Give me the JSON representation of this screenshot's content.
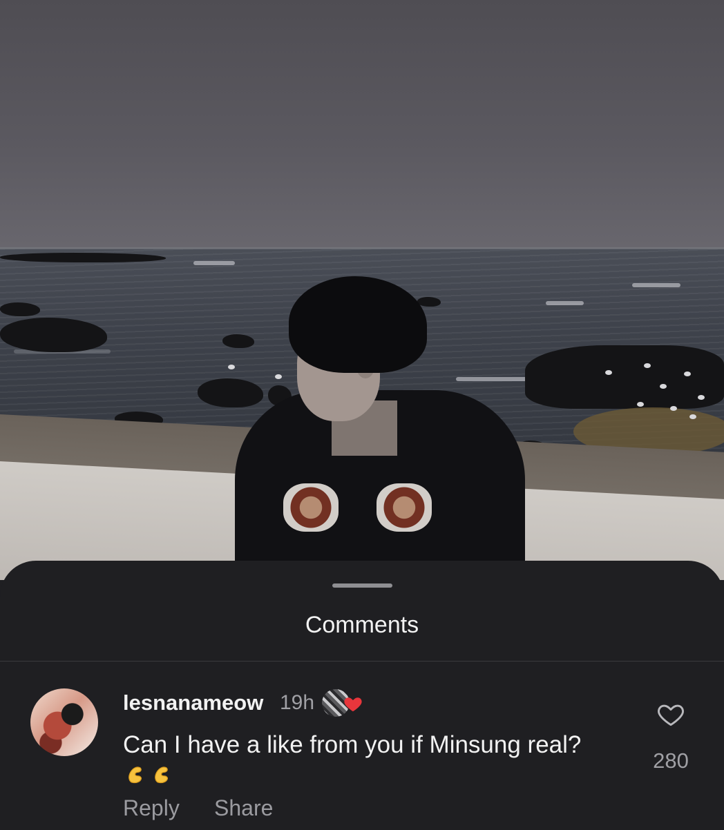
{
  "sheet": {
    "title": "Comments"
  },
  "comment": {
    "username": "lesnanameow",
    "time": "19h",
    "text": "Can I have a like from you if Minsung real?",
    "emojis": [
      "pinching-hand-emoji",
      "pinching-hand-emoji"
    ],
    "like_count": "280",
    "reply_label": "Reply",
    "share_label": "Share",
    "liked_by_creator": true
  },
  "colors": {
    "sheet_background": "#1f1f22",
    "primary_text": "#f2f2f2",
    "secondary_text": "#a0a0a5",
    "heart_red": "#e8363c"
  },
  "icons": {
    "like": "heart-outline-icon",
    "creator_like": "heart-filled-icon"
  }
}
